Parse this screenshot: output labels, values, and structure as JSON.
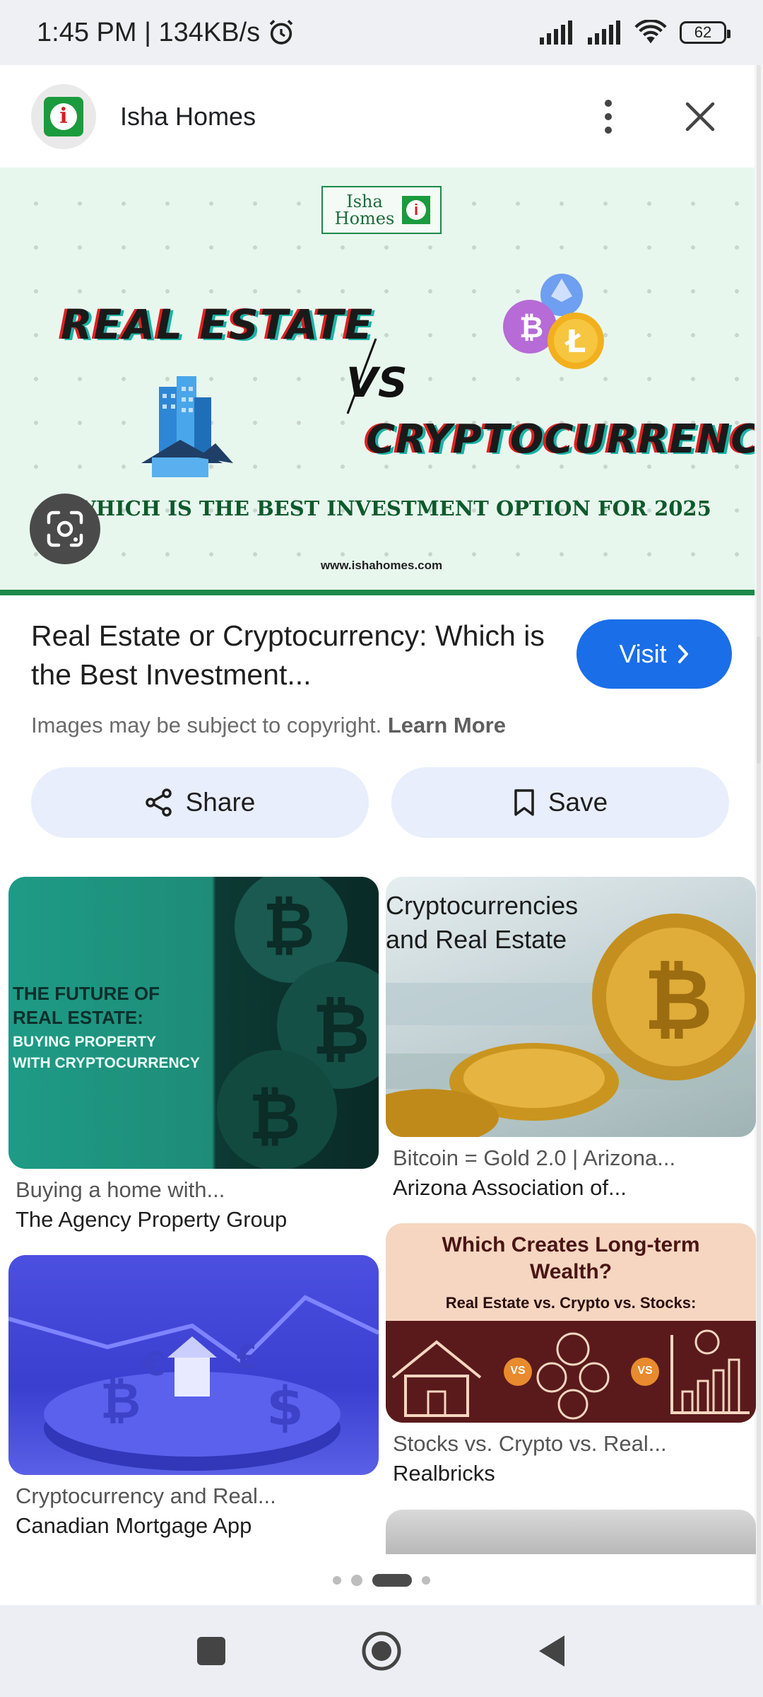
{
  "status_bar": {
    "time": "1:45 PM | 134KB/s",
    "battery": "62"
  },
  "header": {
    "site_name": "Isha Homes"
  },
  "hero": {
    "logo_text": "Isha Homes",
    "headline_1": "REAL ESTATE",
    "vs": "VS",
    "headline_2": "CRYPTOCURRENCY",
    "question": "WHICH IS THE BEST INVESTMENT OPTION FOR 2025",
    "url": "www.ishahomes.com"
  },
  "result": {
    "title": "Real Estate or Cryptocurrency: Which is the Best Investment...",
    "copyright": "Images may be subject to copyright.",
    "learn_more": "Learn More",
    "visit_label": "Visit"
  },
  "actions": {
    "share_label": "Share",
    "save_label": "Save"
  },
  "related": [
    {
      "caption": "Buying a home with...",
      "source": "The Agency Property Group",
      "thumb_text_1": "THE FUTURE OF",
      "thumb_text_2": "REAL ESTATE:",
      "thumb_text_3": "BUYING PROPERTY",
      "thumb_text_4": "WITH CRYPTOCURRENCY"
    },
    {
      "caption": "Bitcoin = Gold 2.0 | Arizona...",
      "source": "Arizona Association of...",
      "thumb_text_1": "Cryptocurrencies",
      "thumb_text_2": "and Real Estate"
    },
    {
      "caption": "Cryptocurrency and Real...",
      "source": "Canadian Mortgage App"
    },
    {
      "caption": "Stocks vs. Crypto vs. Real...",
      "source": "Realbricks",
      "thumb_text_1": "Which Creates Long-term",
      "thumb_text_2": "Wealth?",
      "thumb_text_3": "Real Estate vs. Crypto vs. Stocks:",
      "vs": "VS"
    }
  ],
  "colors": {
    "accent": "#1a6ee8",
    "hero_bg": "#e8f7ee",
    "brand_green": "#1d8a48"
  }
}
